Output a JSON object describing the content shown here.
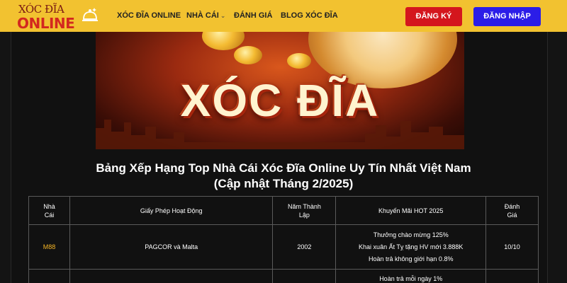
{
  "header": {
    "logo_line1": "XÓC ĐĨA",
    "logo_line2": "ONLINE",
    "nav": [
      {
        "label": "XÓC ĐĨA ONLINE"
      },
      {
        "label": "NHÀ CÁI",
        "has_dropdown": true
      },
      {
        "label": "ĐÁNH GIÁ"
      },
      {
        "label": "BLOG XÓC ĐĨA"
      }
    ],
    "register_label": "ĐĂNG KÝ",
    "login_label": "ĐĂNG NHẬP"
  },
  "banner": {
    "title": "XÓC ĐĨA"
  },
  "heading": {
    "line1": "Bảng Xếp Hạng Top Nhà Cái Xóc Đĩa Online Uy Tín Nhất Việt Nam",
    "line2": "(Cập nhật Tháng 2/2025)"
  },
  "table": {
    "headers": {
      "brand_1": "Nhà",
      "brand_2": "Cái",
      "license": "Giấy Phép Hoạt Động",
      "year_1": "Năm Thành",
      "year_2": "Lập",
      "promo": "Khuyến Mãi HOT 2025",
      "rating_1": "Đánh",
      "rating_2": "Giá"
    },
    "rows": [
      {
        "brand": "M88",
        "license": "PAGCOR và Malta",
        "year": "2002",
        "promo": [
          "Thưởng chào mừng 125%",
          "Khai xuân Ất Tỵ tặng HV mới 3.888K",
          "Hoàn trả không giới hạn 0.8%"
        ],
        "rating": "10/10"
      },
      {
        "promo_first": "Hoàn trả mỗi ngày 1%"
      }
    ]
  },
  "colors": {
    "header_bg": "#f2c230",
    "register_bg": "#d4161d",
    "login_bg": "#2b1de8",
    "brand_text": "#f3b325"
  }
}
